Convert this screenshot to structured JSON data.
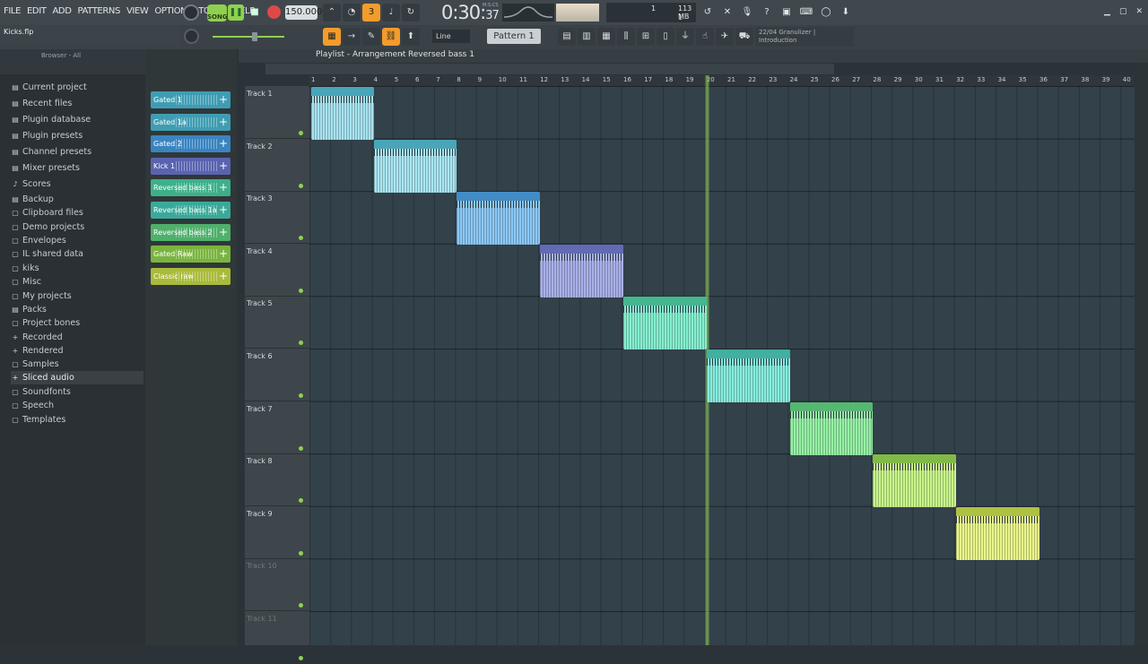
{
  "menu": [
    "FILE",
    "EDIT",
    "ADD",
    "PATTERNS",
    "VIEW",
    "OPTIONS",
    "TOOLS",
    "HELP"
  ],
  "transport": {
    "song_label": "SONG",
    "tempo": "150.000",
    "time": "0:30",
    "time_small": "37",
    "time_units": "M:S:CS"
  },
  "cpu": {
    "a": "1",
    "b": "113 MB",
    "c": "1"
  },
  "file": {
    "name": "Kicks.flp"
  },
  "toolbar": {
    "snap": "Line",
    "pattern": "Pattern 1"
  },
  "hint": {
    "line1": "22/04  Granulizer |",
    "line2": "Introduction"
  },
  "browser": {
    "header": "Browser - All",
    "items": [
      {
        "label": "Current project",
        "icon": "▤"
      },
      {
        "label": "Recent files",
        "icon": "▤"
      },
      {
        "label": "Plugin database",
        "icon": "▤"
      },
      {
        "label": "Plugin presets",
        "icon": "▤"
      },
      {
        "label": "Channel presets",
        "icon": "▤"
      },
      {
        "label": "Mixer presets",
        "icon": "▤"
      },
      {
        "label": "Scores",
        "icon": "♪"
      },
      {
        "label": "Backup",
        "icon": "▤"
      },
      {
        "label": "Clipboard files",
        "icon": "▢"
      },
      {
        "label": "Demo projects",
        "icon": "▢"
      },
      {
        "label": "Envelopes",
        "icon": "▢"
      },
      {
        "label": "IL shared data",
        "icon": "▢"
      },
      {
        "label": "kiks",
        "icon": "▢"
      },
      {
        "label": "Misc",
        "icon": "▢"
      },
      {
        "label": "My projects",
        "icon": "▢"
      },
      {
        "label": "Packs",
        "icon": "▤"
      },
      {
        "label": "Project bones",
        "icon": "▢"
      },
      {
        "label": "Recorded",
        "icon": "+"
      },
      {
        "label": "Rendered",
        "icon": "+"
      },
      {
        "label": "Samples",
        "icon": "▢"
      },
      {
        "label": "Sliced audio",
        "icon": "+"
      },
      {
        "label": "Soundfonts",
        "icon": "▢"
      },
      {
        "label": "Speech",
        "icon": "▢"
      },
      {
        "label": "Templates",
        "icon": "▢"
      }
    ]
  },
  "clips": [
    {
      "label": "Gated 1",
      "color": "#3f9db3"
    },
    {
      "label": "Gated 1a",
      "color": "#3f9db3"
    },
    {
      "label": "Gated 2",
      "color": "#3a84c0"
    },
    {
      "label": "Kick 1",
      "color": "#5a63b0"
    },
    {
      "label": "Reversed bass 1",
      "color": "#3db08a"
    },
    {
      "label": "Reversed bass 1a",
      "color": "#3aa99a"
    },
    {
      "label": "Reversed bass 2",
      "color": "#4fb06b"
    },
    {
      "label": "Gated Raw",
      "color": "#7ab43f"
    },
    {
      "label": "Classic raw",
      "color": "#a9bb3a"
    }
  ],
  "playlist": {
    "title": "Playlist - Arrangement",
    "pattern": "Reversed bass 1"
  },
  "ruler": [
    "1",
    "2",
    "3",
    "4",
    "5",
    "6",
    "7",
    "8",
    "9",
    "10",
    "11",
    "12",
    "13",
    "14",
    "15",
    "16",
    "17",
    "18",
    "19",
    "20",
    "21",
    "22",
    "23",
    "24",
    "25",
    "26",
    "27",
    "28",
    "29",
    "30",
    "31",
    "32",
    "33",
    "34",
    "35",
    "36",
    "37",
    "38",
    "39",
    "40"
  ],
  "tracks": [
    "Track 1",
    "Track 2",
    "Track 3",
    "Track 4",
    "Track 5",
    "Track 6",
    "Track 7",
    "Track 8",
    "Track 9",
    "Track 10",
    "Track 11"
  ],
  "pattern_clips": [
    {
      "track": 1,
      "start": 1,
      "end": 4,
      "color": "#a7e3f0",
      "head": "#3f9db3"
    },
    {
      "track": 2,
      "start": 4,
      "end": 8,
      "color": "#a9e6f2",
      "head": "#3f9db3"
    },
    {
      "track": 3,
      "start": 8,
      "end": 12,
      "color": "#8cc8f5",
      "head": "#3a84c0"
    },
    {
      "track": 4,
      "start": 12,
      "end": 16,
      "color": "#a9b0e8",
      "head": "#5a63b0"
    },
    {
      "track": 5,
      "start": 16,
      "end": 20,
      "color": "#86efd0",
      "head": "#3db08a"
    },
    {
      "track": 6,
      "start": 20,
      "end": 24,
      "color": "#86ecdd",
      "head": "#3aa99a"
    },
    {
      "track": 7,
      "start": 24,
      "end": 28,
      "color": "#96f0a6",
      "head": "#4fb06b"
    },
    {
      "track": 8,
      "start": 28,
      "end": 32,
      "color": "#c8f58a",
      "head": "#7ab43f"
    },
    {
      "track": 9,
      "start": 32,
      "end": 36,
      "color": "#eaf68a",
      "head": "#a9bb3a"
    }
  ]
}
